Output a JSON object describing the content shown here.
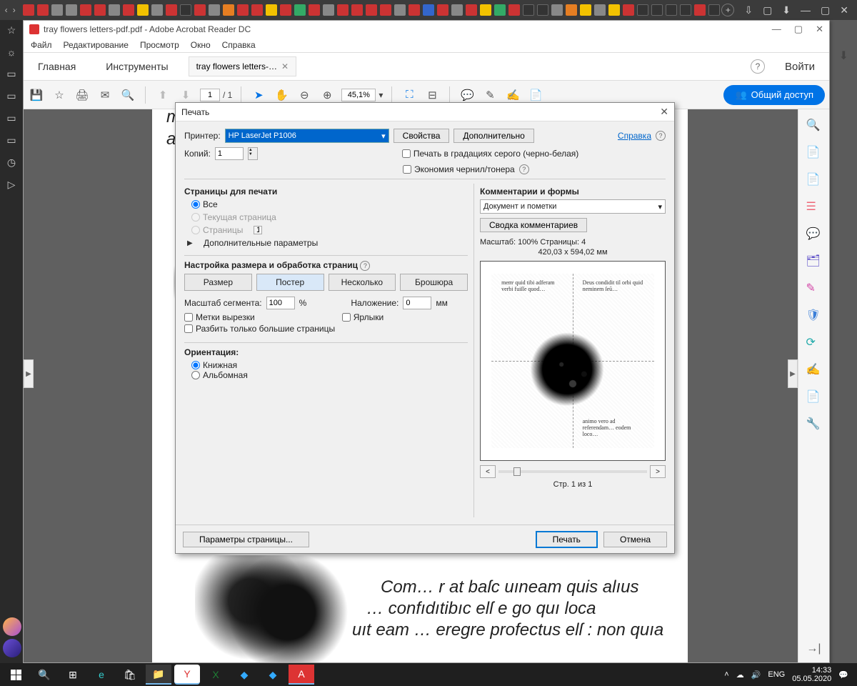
{
  "browser": {
    "nav_back": "‹",
    "nav_fwd": "›"
  },
  "adobe": {
    "title": "tray flowers letters-pdf.pdf - Adobe Acrobat Reader DC",
    "menu": [
      "Файл",
      "Редактирование",
      "Просмотр",
      "Окно",
      "Справка"
    ],
    "tab_home": "Главная",
    "tab_tools": "Инструменты",
    "tab_doc": "tray flowers letters-…",
    "signin": "Войти",
    "page_current": "1",
    "page_total": "/  1",
    "zoom_value": "45,1%",
    "share_label": "Общий доступ"
  },
  "doc_text_top": "memّᶦ quid… tibı adferam…",
  "doc_text_bottom1": "Com… r at baſc uıneam quis alıus",
  "doc_text_bottom2": "… confıdıtibıc elſ e go quı loca",
  "doc_text_bottom3": "uıt eam … eregre profectus elſ : non quıa",
  "print": {
    "title": "Печать",
    "printer_label": "Принтер:",
    "printer_value": "HP LaserJet P1006",
    "properties_btn": "Свойства",
    "advanced_btn": "Дополнительно",
    "help_link": "Справка",
    "copies_label": "Копий:",
    "copies_value": "1",
    "grayscale_label": "Печать в градациях серого (черно-белая)",
    "ink_label": "Экономия чернил/тонера",
    "pages_section": "Страницы для печати",
    "pages_all": "Все",
    "pages_current": "Текущая страница",
    "pages_range_label": "Страницы",
    "pages_range_value": "1",
    "additional_params": "Дополнительные параметры",
    "handling_section": "Настройка размера и обработка страниц",
    "size_btn": "Размер",
    "poster_btn": "Постер",
    "multiple_btn": "Несколько",
    "booklet_btn": "Брошюра",
    "scale_label": "Масштаб сегмента:",
    "scale_value": "100",
    "scale_pct": "%",
    "overlap_label": "Наложение:",
    "overlap_value": "0",
    "overlap_unit": "мм",
    "cut_marks": "Метки вырезки",
    "labels_chk": "Ярлыки",
    "split_big": "Разбить только большие страницы",
    "orientation_section": "Ориентация:",
    "orient_portrait": "Книжная",
    "orient_landscape": "Альбомная",
    "comments_section": "Комментарии и формы",
    "comments_combo": "Документ и пометки",
    "summarize_btn": "Сводка комментариев",
    "scale_preview": "Масштаб: 100% Страницы: 4",
    "dims": "420,03 x 594,02 мм",
    "page_of": "Стр. 1 из 1",
    "page_setup": "Параметры страницы...",
    "print_btn": "Печать",
    "cancel_btn": "Отмена"
  },
  "taskbar": {
    "lang": "ENG",
    "time": "14:33",
    "date": "05.05.2020"
  }
}
